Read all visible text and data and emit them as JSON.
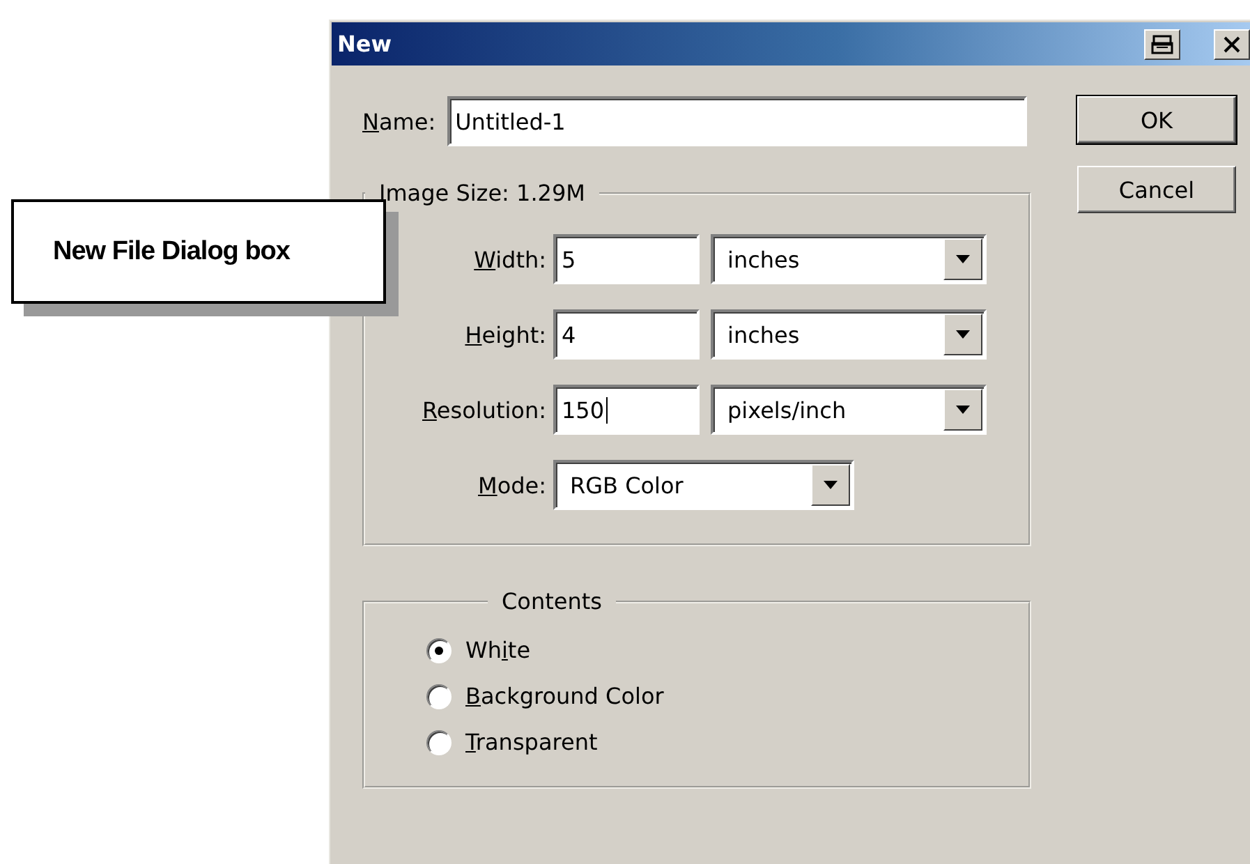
{
  "window": {
    "title": "New"
  },
  "callout": {
    "text": "New File Dialog box"
  },
  "name_field": {
    "label": {
      "key": "N",
      "after": "ame:"
    },
    "value": "Untitled-1"
  },
  "buttons": [
    {
      "label": "OK",
      "default": true
    },
    {
      "label": "Cancel",
      "default": false
    }
  ],
  "image_size": {
    "legend": "Image Size:  1.29M",
    "rows": [
      {
        "kind": "measure",
        "label": {
          "key": "W",
          "after": "idth:"
        },
        "value": "5",
        "focused": false,
        "unit": "inches"
      },
      {
        "kind": "measure",
        "label": {
          "key": "H",
          "after": "eight:"
        },
        "value": "4",
        "focused": false,
        "unit": "inches"
      },
      {
        "kind": "measure",
        "label": {
          "key": "R",
          "after": "esolution:"
        },
        "value": "150",
        "focused": true,
        "unit": "pixels/inch"
      },
      {
        "kind": "mode",
        "label": {
          "key": "M",
          "after": "ode:"
        },
        "value": "RGB Color"
      }
    ]
  },
  "contents": {
    "legend": "Contents",
    "options": [
      {
        "label": {
          "before": "Wh",
          "key": "i",
          "after": "te"
        },
        "selected": true
      },
      {
        "label": {
          "key": "B",
          "after": "ackground Color"
        },
        "selected": false
      },
      {
        "label": {
          "key": "T",
          "after": "ransparent"
        },
        "selected": false
      }
    ]
  }
}
